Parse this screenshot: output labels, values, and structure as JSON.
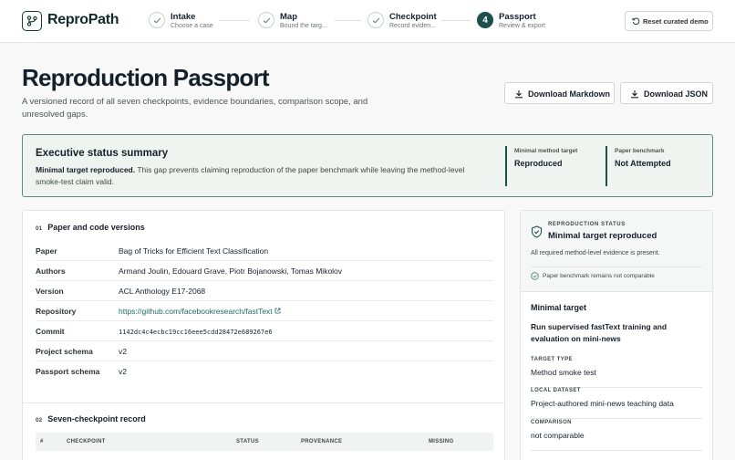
{
  "app": {
    "name": "ReproPath"
  },
  "steps": [
    {
      "title": "Intake",
      "sub": "Choose a case",
      "state": "done"
    },
    {
      "title": "Map",
      "sub": "Bound the targ...",
      "state": "done"
    },
    {
      "title": "Checkpoint",
      "sub": "Record eviden...",
      "state": "done"
    },
    {
      "title": "Passport",
      "sub": "Review & export",
      "state": "active",
      "number": "4"
    }
  ],
  "header": {
    "reset_label": "Reset curated demo"
  },
  "page": {
    "title": "Reproduction Passport",
    "subtitle": "A versioned record of all seven checkpoints, evidence boundaries, comparison scope, and unresolved gaps.",
    "download_markdown": "Download Markdown",
    "download_json": "Download JSON"
  },
  "summary": {
    "title": "Executive status summary",
    "lead": "Minimal target reproduced.",
    "body": "This gap prevents claiming reproduction of the paper benchmark while leaving the method-level smoke-test claim valid.",
    "stats": [
      {
        "label": "Minimal method target",
        "value": "Reproduced"
      },
      {
        "label": "Paper benchmark",
        "value": "Not Attempted"
      }
    ]
  },
  "versions": {
    "number": "01",
    "title": "Paper and code versions",
    "rows": [
      {
        "key": "Paper",
        "value": "Bag of Tricks for Efficient Text Classification"
      },
      {
        "key": "Authors",
        "value": "Armand Joulin, Edouard Grave, Piotr Bojanowski, Tomas Mikolov"
      },
      {
        "key": "Version",
        "value": "ACL Anthology E17-2068"
      },
      {
        "key": "Repository",
        "value": "https://github.com/facebookresearch/fastText"
      },
      {
        "key": "Commit",
        "value": "1142dc4c4ecbc19cc16eee5cdd28472e689267e6"
      },
      {
        "key": "Project schema",
        "value": "v2"
      },
      {
        "key": "Passport schema",
        "value": "v2"
      }
    ]
  },
  "checkpoints": {
    "number": "02",
    "title": "Seven-checkpoint record",
    "columns": [
      "#",
      "CHECKPOINT",
      "STATUS",
      "PROVENANCE",
      "MISSING"
    ]
  },
  "status_card": {
    "kicker": "REPRODUCTION STATUS",
    "title": "Minimal target reproduced",
    "desc": "All required method-level evidence is present.",
    "note": "Paper benchmark remains not comparable"
  },
  "minimal_target": {
    "title": "Minimal target",
    "desc": "Run supervised fastText training and evaluation on mini-news",
    "fields": [
      {
        "key": "TARGET TYPE",
        "value": "Method smoke test"
      },
      {
        "key": "LOCAL DATASET",
        "value": "Project-authored mini-news teaching data"
      },
      {
        "key": "COMPARISON",
        "value": "not comparable"
      }
    ]
  },
  "colors": {
    "accent": "#1d4f4c",
    "summary_bg": "#eff4f1",
    "link": "#1d6a65"
  }
}
